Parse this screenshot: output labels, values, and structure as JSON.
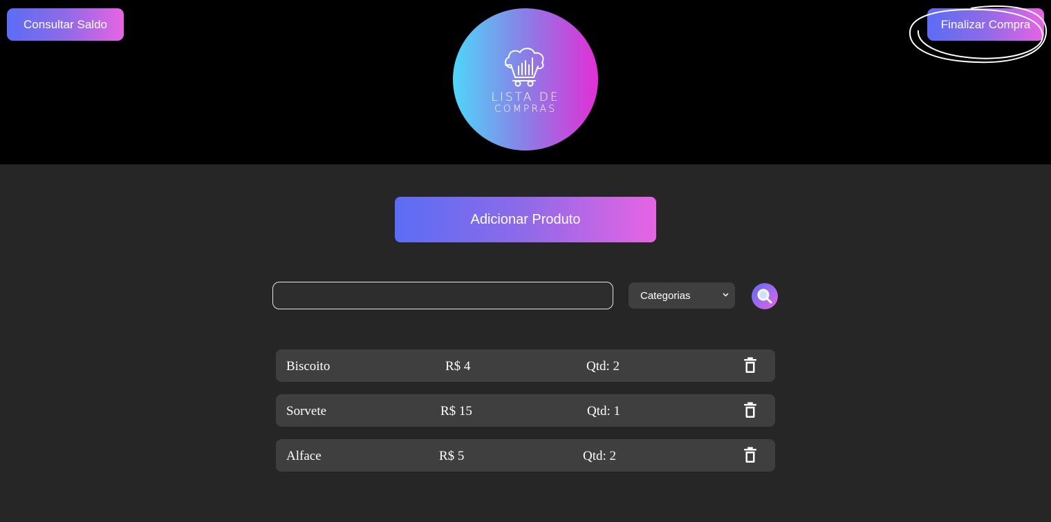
{
  "header": {
    "saldo_label": "Consultar Saldo",
    "finalizar_label": "Finalizar Compra",
    "logo": {
      "line1": "LISTA DE",
      "line2": "COMPRAS",
      "icon": "cloud-cart-icon"
    }
  },
  "main": {
    "add_label": "Adicionar Produto",
    "search": {
      "value": "",
      "placeholder": "",
      "icon": "search-icon"
    },
    "category": {
      "selected": "Categorias",
      "icon": "chevron-down-icon"
    },
    "items": [
      {
        "name": "Biscoito",
        "price": "R$ 4",
        "qty": "Qtd: 2"
      },
      {
        "name": "Sorvete",
        "price": "R$ 15",
        "qty": "Qtd: 1"
      },
      {
        "name": "Alface",
        "price": "R$ 5",
        "qty": "Qtd: 2"
      }
    ],
    "delete_icon": "trash-icon"
  },
  "colors": {
    "gradient_start": "#5b6df5",
    "gradient_end": "#e764e3",
    "logo_gradient_start": "#4fd6f8",
    "logo_gradient_end": "#e22fd6",
    "header_bg": "#000000",
    "page_bg": "#262626",
    "row_bg": "#3f3f3f"
  }
}
